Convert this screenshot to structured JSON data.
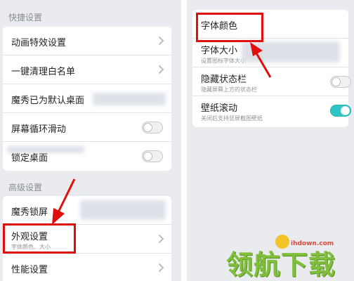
{
  "left_panel": {
    "quick_section": {
      "title": "快捷设置",
      "rows": [
        {
          "label": "动画特效设置",
          "control": "chevron"
        },
        {
          "label": "一键清理白名单",
          "control": "chevron"
        },
        {
          "label": "魔秀已为默认桌面",
          "control": "none"
        },
        {
          "label": "屏幕循环滑动",
          "control": "toggle-off"
        },
        {
          "label": "锁定桌面",
          "control": "toggle-off"
        }
      ]
    },
    "advanced_section": {
      "title": "高级设置",
      "rows": [
        {
          "label": "魔秀锁屏",
          "control": "none"
        },
        {
          "label": "外观设置",
          "sub": "字体颜色、大小",
          "control": "chevron"
        },
        {
          "label": "性能设置",
          "control": "chevron"
        }
      ]
    }
  },
  "right_panel": {
    "rows": [
      {
        "label": "字体颜色",
        "control": "none"
      },
      {
        "label": "字体大小",
        "sub": "设置图标字体大小",
        "control": "none"
      },
      {
        "label": "隐藏状态栏",
        "sub": "隐藏屏幕上方的状态栏",
        "control": "toggle-off"
      },
      {
        "label": "壁纸滚动",
        "sub": "关闭后支持竖屏截图壁纸",
        "control": "toggle-on"
      }
    ]
  },
  "watermark": {
    "text": "领航下载",
    "url": "ihdown.com"
  },
  "colors": {
    "highlight": "#e10e0e",
    "toggle_on": "#2ec4c4",
    "watermark": "#7fbf3b"
  }
}
